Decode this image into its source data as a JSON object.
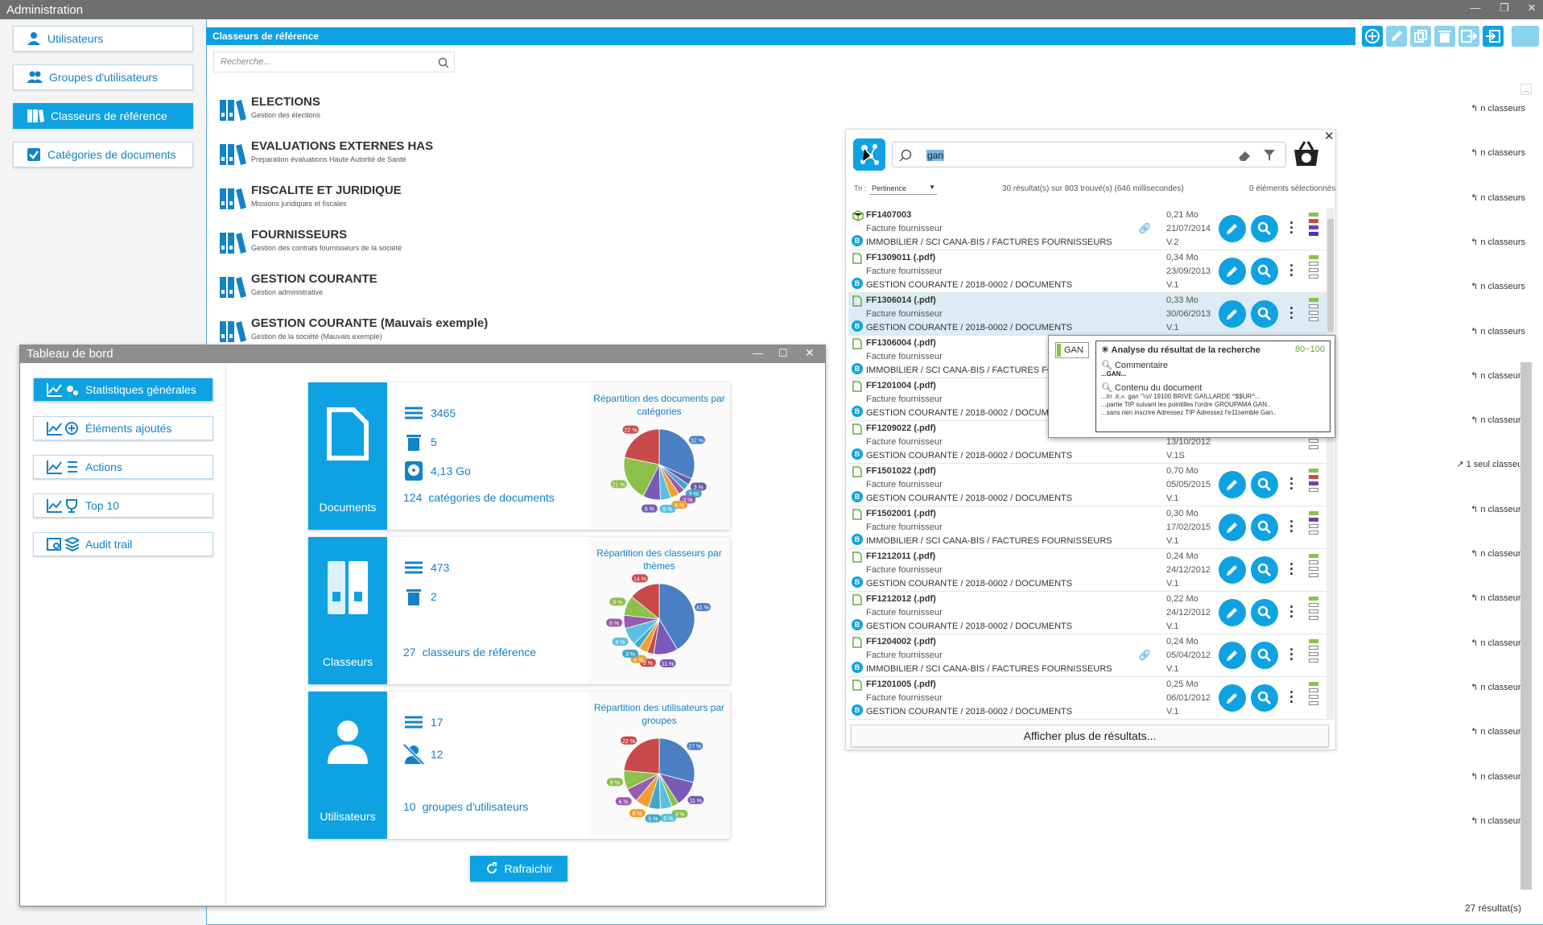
{
  "window": {
    "title": "Administration"
  },
  "nav": {
    "items": [
      {
        "label": "Utilisateurs"
      },
      {
        "label": "Groupes d'utilisateurs"
      },
      {
        "label": "Classeurs de référence"
      },
      {
        "label": "Catégories de documents"
      }
    ]
  },
  "main": {
    "header": "Classeurs de référence",
    "search_placeholder": "Recherche...",
    "result_count": "27 résultat(s)"
  },
  "classeurs": [
    {
      "name": "ELECTIONS",
      "desc": "Gestion des élections",
      "count": "n classeurs"
    },
    {
      "name": "EVALUATIONS EXTERNES HAS",
      "desc": "Preparation évaluations Haute Autorité de Santé",
      "count": "n classeurs"
    },
    {
      "name": "FISCALITE ET JURIDIQUE",
      "desc": "Missions juridiques et fiscales",
      "count": "n classeurs"
    },
    {
      "name": "FOURNISSEURS",
      "desc": "Gestion des contrats fournisseurs de la société",
      "count": "n classeurs"
    },
    {
      "name": "GESTION COURANTE",
      "desc": "Gestion administrative",
      "count": "n classeurs"
    },
    {
      "name": "GESTION COURANTE (Mauvais exemple)",
      "desc": "Gestion de la société (Mauvais exemple)",
      "count": "1 seul classeur"
    }
  ],
  "right_counts": [
    "n classeurs",
    "n classeurs",
    "n classeurs",
    "n classeurs",
    "n classeurs",
    "n classeurs",
    "n classeurs",
    "n classeurs",
    "1 seul classeur",
    "n classeurs",
    "n classeurs",
    "n classeurs",
    "n classeurs",
    "n classeurs",
    "n classeurs",
    "n classeurs",
    "n classeurs"
  ],
  "dashboard": {
    "title": "Tableau de bord",
    "menu": [
      {
        "label": "Statistiques générales"
      },
      {
        "label": "Éléments ajoutés"
      },
      {
        "label": "Actions"
      },
      {
        "label": "Top 10"
      },
      {
        "label": "Audit trail"
      }
    ],
    "refresh": "Rafraichir",
    "cards": [
      {
        "label": "Documents",
        "stats": [
          "3465",
          "5",
          "4,13 Go"
        ],
        "footer_num": "124",
        "footer_text": "catégories de documents",
        "pie_title": "Répartition des documents par catégories",
        "pie_slices": [
          {
            "v": 32,
            "c": "#4b7fc4"
          },
          {
            "v": 3,
            "c": "#6a5aa8"
          },
          {
            "v": 3,
            "c": "#3fa7c9"
          },
          {
            "v": 3,
            "c": "#9a5ab0"
          },
          {
            "v": 4,
            "c": "#f0a030"
          },
          {
            "v": 5,
            "c": "#5bc0e0"
          },
          {
            "v": 8,
            "c": "#7a5ab8"
          },
          {
            "v": 21,
            "c": "#8cc04a"
          },
          {
            "v": 22,
            "c": "#c94a4a"
          }
        ],
        "pie_labels": [
          "32 %",
          "3 %",
          "3 %",
          "3 %",
          "4 %",
          "5 %",
          "8 %",
          "21 %",
          "22 %"
        ]
      },
      {
        "label": "Classeurs",
        "stats": [
          "473",
          "2"
        ],
        "footer_num": "27",
        "footer_text": "classeurs de référence",
        "pie_title": "Répartition des classeurs par thèmes",
        "pie_slices": [
          {
            "v": 41,
            "c": "#4b7fc4"
          },
          {
            "v": 11,
            "c": "#7a5ab8"
          },
          {
            "v": 3,
            "c": "#c94a4a"
          },
          {
            "v": 4,
            "c": "#f0a030"
          },
          {
            "v": 3,
            "c": "#3fa7c9"
          },
          {
            "v": 8,
            "c": "#5bc0e0"
          },
          {
            "v": 6,
            "c": "#9a5ab0"
          },
          {
            "v": 9,
            "c": "#8cc04a"
          },
          {
            "v": 14,
            "c": "#c94a4a"
          }
        ],
        "pie_labels": [
          "41 %",
          "11 %",
          "3 %",
          "4 %",
          "3 %",
          "8 %",
          "6 %",
          "9 %",
          "14 %"
        ]
      },
      {
        "label": "Utilisateurs",
        "stats": [
          "17",
          "12"
        ],
        "footer_num": "10",
        "footer_text": "groupes d'utilisateurs",
        "pie_title": "Répartition des utilisateurs par groupes",
        "pie_slices": [
          {
            "v": 27,
            "c": "#4b7fc4"
          },
          {
            "v": 11,
            "c": "#7a5ab8"
          },
          {
            "v": 3,
            "c": "#8cc04a"
          },
          {
            "v": 5,
            "c": "#5bc0e0"
          },
          {
            "v": 5,
            "c": "#3fa7c9"
          },
          {
            "v": 6,
            "c": "#f0a030"
          },
          {
            "v": 6,
            "c": "#9a5ab0"
          },
          {
            "v": 8,
            "c": "#8cc04a"
          },
          {
            "v": 22,
            "c": "#c94a4a"
          }
        ],
        "pie_labels": [
          "27 %",
          "11 %",
          "3 %",
          "5 %",
          "5 %",
          "6 %",
          "6 %",
          "8 %",
          "22 %"
        ]
      }
    ]
  },
  "search": {
    "query": "gan",
    "sort_label": "Tri :",
    "sort_value": "Pertinence",
    "info": "30 résultat(s) sur 803 trouvé(s) (646 millisecondes)",
    "selected": "0 éléments sélectionnés",
    "more": "Afficher plus de résultats...",
    "results": [
      {
        "name": "FF1407003",
        "type": "Facture fournisseur",
        "path": "IMMOBILIER / SCI CANA-BIS / FACTURES FOURNISSEURS",
        "size": "0,21 Mo",
        "date": "21/07/2014",
        "ver": "V.2"
      },
      {
        "name": "FF1309011 (.pdf)",
        "type": "Facture fournisseur",
        "path": "GESTION COURANTE / 2018-0002 / DOCUMENTS",
        "size": "0,34 Mo",
        "date": "23/09/2013",
        "ver": "V.1"
      },
      {
        "name": "FF1306014 (.pdf)",
        "type": "Facture fournisseur",
        "path": "GESTION COURANTE / 2018-0002 / DOCUMENTS",
        "size": "0,33 Mo",
        "date": "30/06/2013",
        "ver": "V.1"
      },
      {
        "name": "FF1306004 (.pdf)",
        "type": "Facture fournisseur",
        "path": "IMMOBILIER / SCI CANA-BIS / FACTURES FOU",
        "size": "",
        "date": "",
        "ver": ""
      },
      {
        "name": "FF1201004 (.pdf)",
        "type": "Facture fournisseur",
        "path": "GESTION COURANTE / 2018-0002 / DOCUMEI",
        "size": "",
        "date": "",
        "ver": ""
      },
      {
        "name": "FF1209022 (.pdf)",
        "type": "Facture fournisseur",
        "path": "GESTION COURANTE / 2018-0002 / DOCUMENTS",
        "size": "",
        "date": "13/10/2012",
        "ver": "V.1S"
      },
      {
        "name": "FF1501022 (.pdf)",
        "type": "Facture fournisseur",
        "path": "GESTION COURANTE / 2018-0002 / DOCUMENTS",
        "size": "0,70 Mo",
        "date": "05/05/2015",
        "ver": "V.1"
      },
      {
        "name": "FF1502001 (.pdf)",
        "type": "Facture fournisseur",
        "path": "IMMOBILIER / SCI CANA-BIS / FACTURES FOURNISSEURS",
        "size": "0,30 Mo",
        "date": "17/02/2015",
        "ver": "V.1"
      },
      {
        "name": "FF1212011 (.pdf)",
        "type": "Facture fournisseur",
        "path": "GESTION COURANTE / 2018-0002 / DOCUMENTS",
        "size": "0,24 Mo",
        "date": "24/12/2012",
        "ver": "V.1"
      },
      {
        "name": "FF1212012 (.pdf)",
        "type": "Facture fournisseur",
        "path": "GESTION COURANTE / 2018-0002 / DOCUMENTS",
        "size": "0,22 Mo",
        "date": "24/12/2012",
        "ver": "V.1"
      },
      {
        "name": "FF1204002 (.pdf)",
        "type": "Facture fournisseur",
        "path": "IMMOBILIER / SCI CANA-BIS / FACTURES FOURNISSEURS",
        "size": "0,24 Mo",
        "date": "05/04/2012",
        "ver": "V.1"
      },
      {
        "name": "FF1201005 (.pdf)",
        "type": "Facture fournisseur",
        "path": "GESTION COURANTE / 2018-0002 / DOCUMENTS",
        "size": "0,25 Mo",
        "date": "06/01/2012",
        "ver": "V.1"
      }
    ]
  },
  "tooltip": {
    "tag": "GAN",
    "title": "Analyse du résultat de la recherche",
    "score": "80~100",
    "comment_title": "Commentaire",
    "comment_text": "...GAN...",
    "content_title": "Contenu du document",
    "lines": [
      "...lrr .lr,». gan \"½// 19100 BRIVE GAILLARDE ^$$UR^...",
      "...partie TIP suivant les pointilles l'ordre GROUPAMA GAN..",
      "...sans rien inscrire Adressez TIP Adressez l'e11semble Gan.."
    ]
  }
}
